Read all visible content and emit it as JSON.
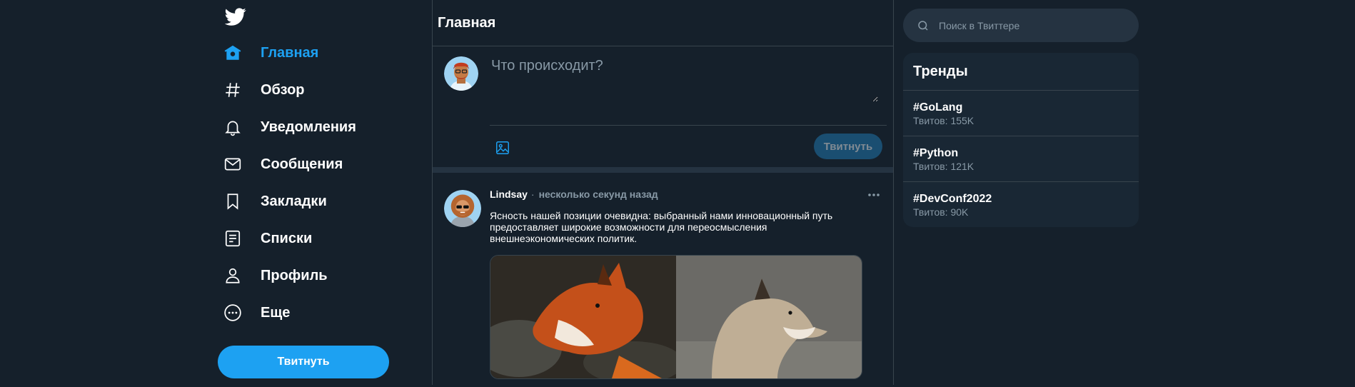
{
  "colors": {
    "accent": "#1da1f2",
    "background": "#15202b",
    "secondary_text": "#8899a6",
    "border": "#38444d"
  },
  "sidebar": {
    "logo_icon": "twitter-bird-icon",
    "items": [
      {
        "label": "Главная",
        "icon": "home-icon",
        "active": true
      },
      {
        "label": "Обзор",
        "icon": "hashtag-icon"
      },
      {
        "label": "Уведомления",
        "icon": "bell-icon"
      },
      {
        "label": "Сообщения",
        "icon": "envelope-icon"
      },
      {
        "label": "Закладки",
        "icon": "bookmark-icon"
      },
      {
        "label": "Списки",
        "icon": "list-icon"
      },
      {
        "label": "Профиль",
        "icon": "user-icon"
      },
      {
        "label": "Еще",
        "icon": "more-circle-icon"
      }
    ],
    "tweet_button": "Твитнуть"
  },
  "main": {
    "title": "Главная",
    "compose": {
      "placeholder": "Что происходит?",
      "media_icon": "image-icon",
      "tweet_button": "Твитнуть"
    },
    "tweet": {
      "author": "Lindsay",
      "separator": "·",
      "time": "несколько секунд назад",
      "text": "Ясность нашей позиции очевидна: выбранный нами инновационный путь предоставляет широкие возможности для переосмысления внешнеэкономических политик.",
      "more_icon": "more-horizontal-icon"
    }
  },
  "right": {
    "search_placeholder": "Поиск в Твиттере",
    "trends_title": "Тренды",
    "trends": [
      {
        "tag": "#GoLang",
        "count": "Твитов: 155K"
      },
      {
        "tag": "#Python",
        "count": "Твитов: 121K"
      },
      {
        "tag": "#DevConf2022",
        "count": "Твитов: 90K"
      }
    ]
  }
}
